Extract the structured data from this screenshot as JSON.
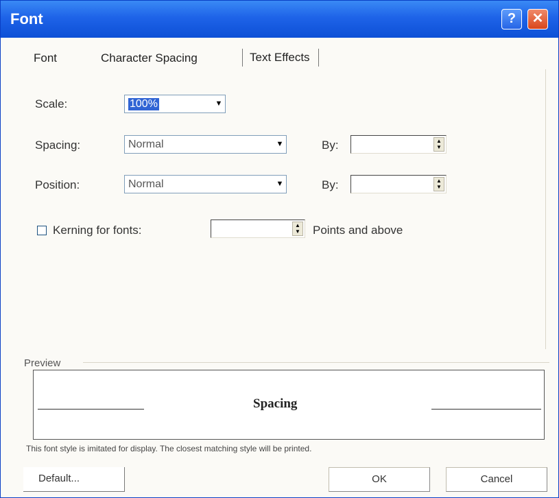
{
  "window": {
    "title": "Font",
    "help_glyph": "?",
    "close_glyph": "✕"
  },
  "tabs": [
    {
      "label": "Font"
    },
    {
      "label": "Character Spacing"
    },
    {
      "label": "Text Effects"
    }
  ],
  "active_tab": "Character Spacing",
  "fields": {
    "scale": {
      "label": "Scale:",
      "value": "100%"
    },
    "spacing": {
      "label": "Spacing:",
      "value": "Normal",
      "by_label": "By:",
      "by_value": ""
    },
    "position": {
      "label": "Position:",
      "value": "Normal",
      "by_label": "By:",
      "by_value": ""
    },
    "kerning": {
      "label": "Kerning for fonts:",
      "checked": false,
      "value": "",
      "suffix": "Points and above"
    }
  },
  "preview": {
    "label": "Preview",
    "sample_text": "Spacing",
    "note": "This font style is imitated for display. The closest matching style will be printed."
  },
  "buttons": {
    "default": "Default...",
    "ok": "OK",
    "cancel": "Cancel"
  },
  "colors": {
    "titlebar": "#1e63e8",
    "selection": "#3064d4",
    "close": "#d9461c"
  }
}
